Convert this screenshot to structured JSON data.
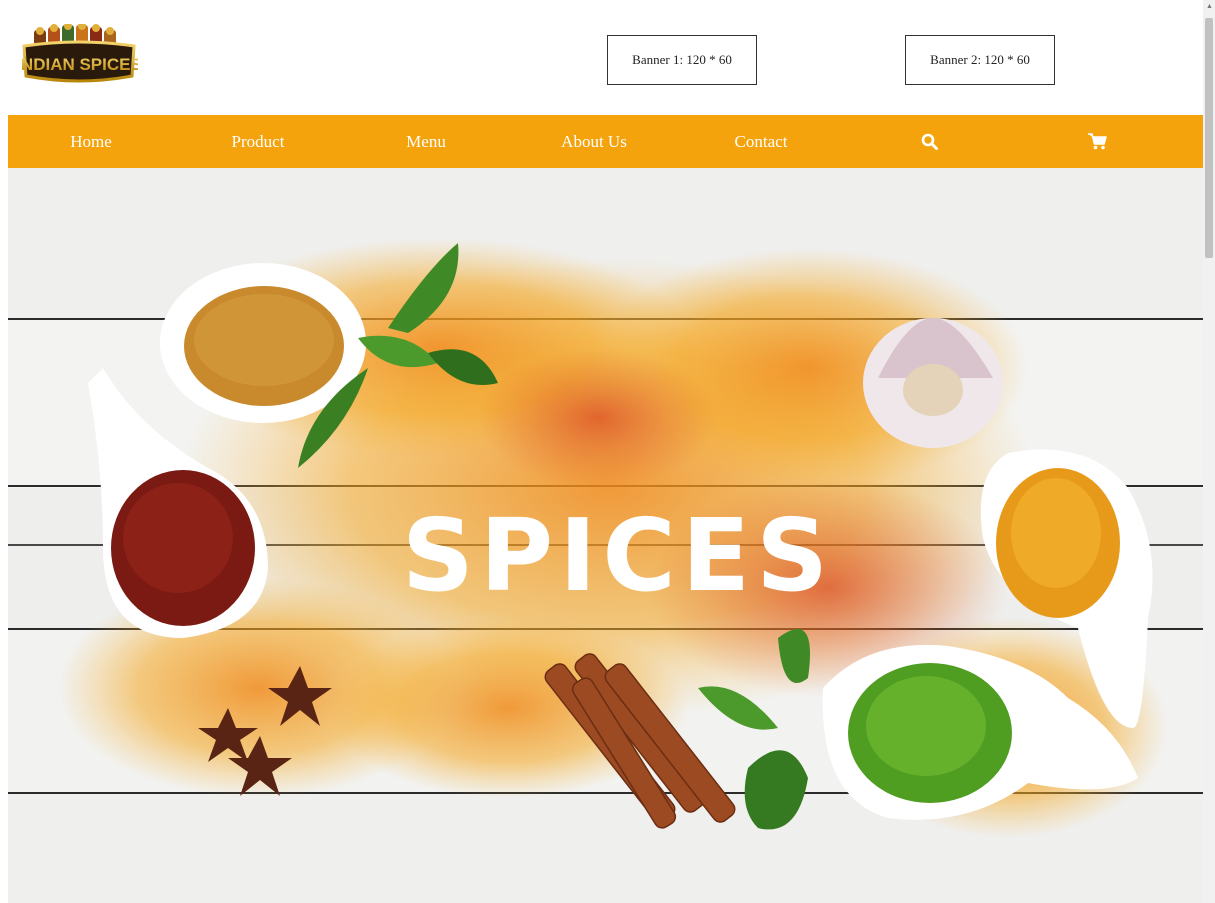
{
  "logo": {
    "text": "INDIAN SPICES"
  },
  "banners": [
    {
      "label": "Banner 1: 120 * 60"
    },
    {
      "label": "Banner 2: 120 * 60"
    }
  ],
  "nav": {
    "items": [
      {
        "label": "Home"
      },
      {
        "label": "Product"
      },
      {
        "label": "Menu"
      },
      {
        "label": "About Us"
      },
      {
        "label": "Contact"
      }
    ],
    "search_icon": "search-icon",
    "cart_icon": "cart-icon",
    "color": "#f5a30c"
  },
  "hero": {
    "word": "SPICES"
  }
}
